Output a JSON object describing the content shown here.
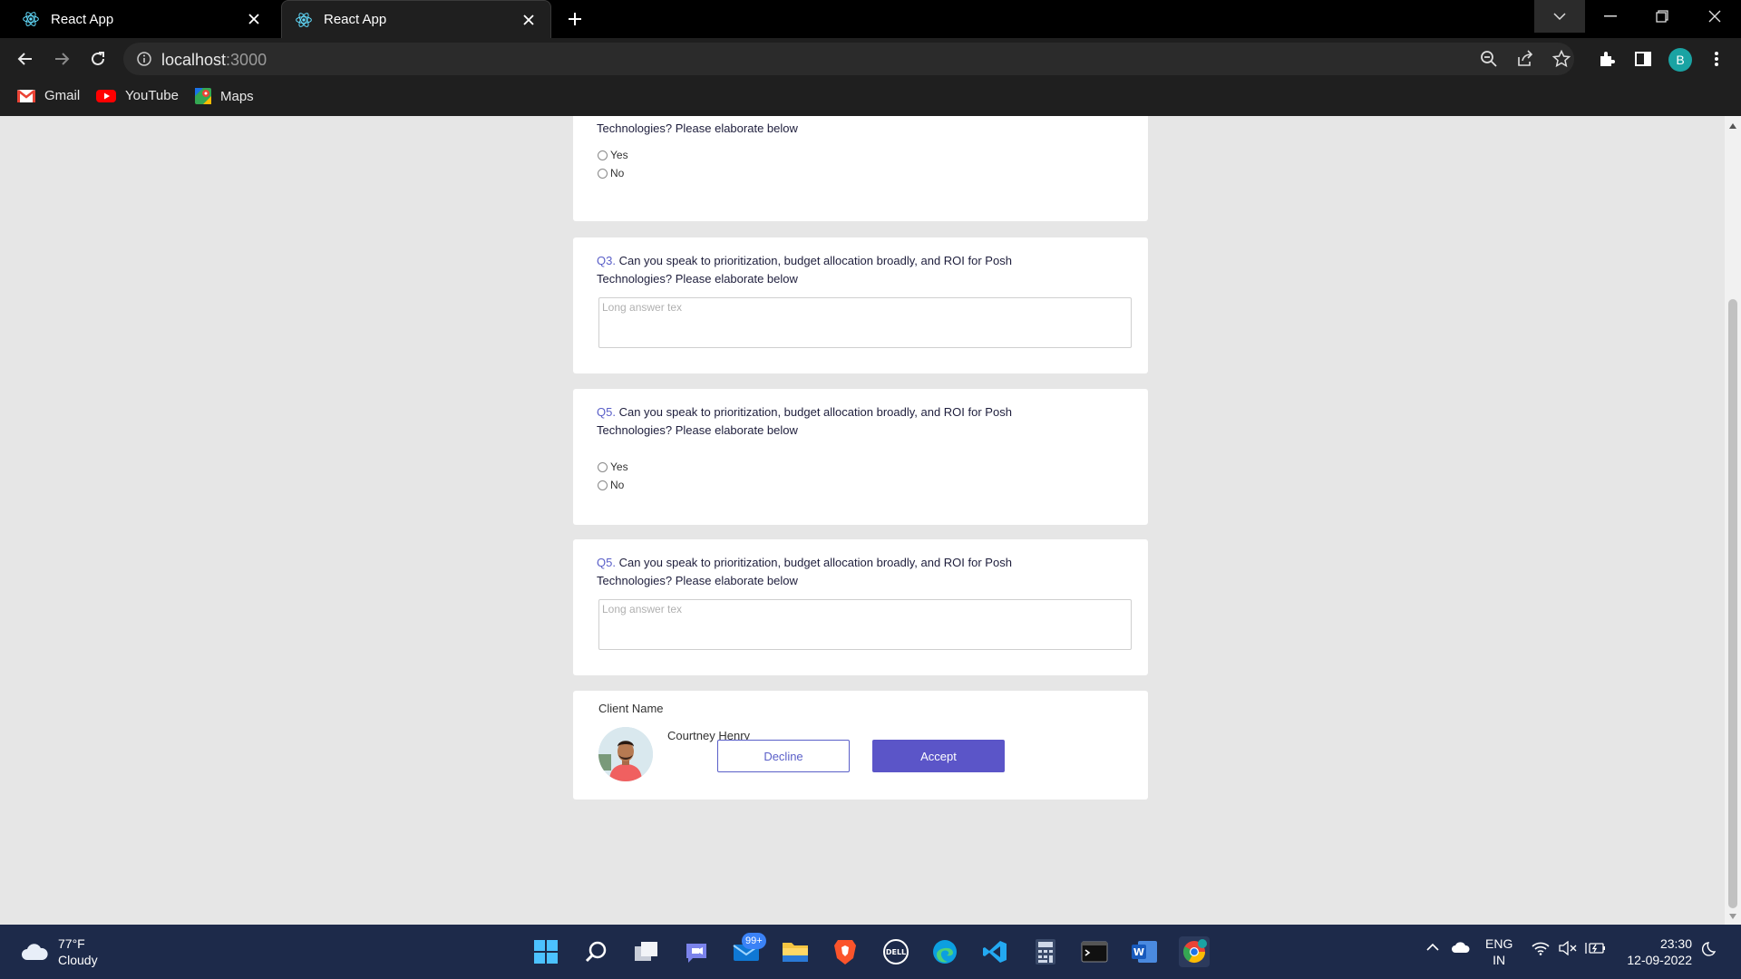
{
  "browser": {
    "tabs": [
      {
        "label": "React App"
      },
      {
        "label": "React App"
      }
    ],
    "url_host": "localhost",
    "url_port": ":3000",
    "profile_initial": "B",
    "bookmarks": [
      {
        "label": "Gmail"
      },
      {
        "label": "YouTube"
      },
      {
        "label": "Maps"
      }
    ]
  },
  "form": {
    "q_top_text": "Technologies? Please elaborate below",
    "questions": [
      {
        "number": "Q3.",
        "text": " Can you speak to prioritization, budget allocation broadly, and ROI for Posh Technologies? Please elaborate below",
        "placeholder": "Long answer tex"
      },
      {
        "number": "Q5.",
        "text": " Can you speak to prioritization, budget allocation broadly, and ROI for Posh Technologies? Please elaborate below"
      },
      {
        "number": "Q5.",
        "text": " Can you speak to prioritization, budget allocation broadly, and ROI for Posh Technologies? Please elaborate below",
        "placeholder": "Long answer tex"
      }
    ],
    "options": {
      "yes": "Yes",
      "no": "No"
    },
    "client_label": "Client Name",
    "client_name": "Courtney Henry",
    "decline_label": "Decline",
    "accept_label": "Accept"
  },
  "taskbar": {
    "temperature": "77°F",
    "condition": "Cloudy",
    "mail_badge": "99+",
    "lang_1": "ENG",
    "lang_2": "IN",
    "time": "23:30",
    "date": "12-09-2022"
  },
  "colors": {
    "accent": "#5b55c8",
    "question_number": "#5a5fc8",
    "page_bg": "#e6e6e6"
  }
}
